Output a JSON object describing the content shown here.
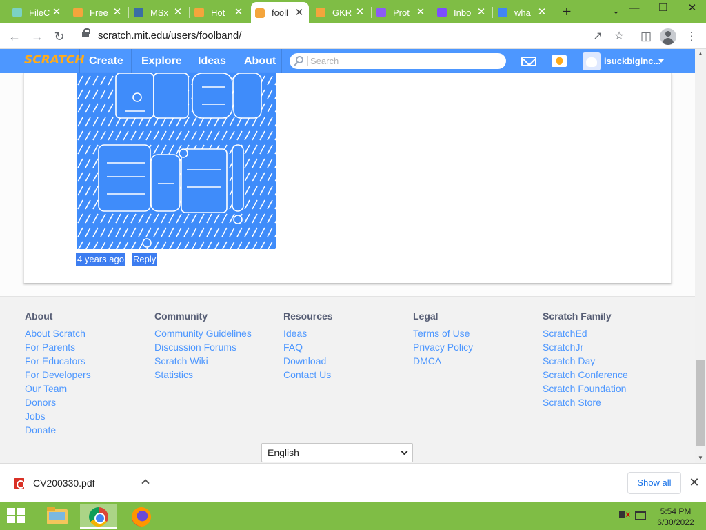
{
  "browser": {
    "tabs": [
      {
        "title": "FileC",
        "favicon_color": "#7bd2c4"
      },
      {
        "title": "Free",
        "favicon_color": "#f4a53c"
      },
      {
        "title": "MSx",
        "favicon_color": "#3a6ea5"
      },
      {
        "title": "Hot",
        "favicon_color": "#f4a53c"
      },
      {
        "title": "fooll",
        "favicon_color": "#f4a53c",
        "active": true
      },
      {
        "title": "GKR",
        "favicon_color": "#f4a53c"
      },
      {
        "title": "Prot",
        "favicon_color": "#8b5cf6"
      },
      {
        "title": "Inbo",
        "favicon_color": "#7c4dff"
      },
      {
        "title": "wha",
        "favicon_color": "#4285f4"
      }
    ],
    "new_tab_label": "+",
    "url": "scratch.mit.edu/users/foolband/"
  },
  "scratch_nav": {
    "logo": "SCRATCH",
    "links": [
      "Create",
      "Explore",
      "Ideas",
      "About"
    ],
    "search_placeholder": "Search",
    "username": "isuckbiginc..."
  },
  "comment": {
    "time": "4 years ago",
    "reply": "Reply"
  },
  "footer": {
    "columns": [
      {
        "heading": "About",
        "links": [
          "About Scratch",
          "For Parents",
          "For Educators",
          "For Developers",
          "Our Team",
          "Donors",
          "Jobs",
          "Donate"
        ]
      },
      {
        "heading": "Community",
        "links": [
          "Community Guidelines",
          "Discussion Forums",
          "Scratch Wiki",
          "Statistics"
        ]
      },
      {
        "heading": "Resources",
        "links": [
          "Ideas",
          "FAQ",
          "Download",
          "Contact Us"
        ]
      },
      {
        "heading": "Legal",
        "links": [
          "Terms of Use",
          "Privacy Policy",
          "DMCA"
        ]
      },
      {
        "heading": "Scratch Family",
        "links": [
          "ScratchEd",
          "ScratchJr",
          "Scratch Day",
          "Scratch Conference",
          "Scratch Foundation",
          "Scratch Store"
        ]
      }
    ],
    "language": "English"
  },
  "downloads": {
    "file": "CV200330.pdf",
    "show_all": "Show all"
  },
  "taskbar": {
    "time": "5:54 PM",
    "date": "6/30/2022"
  },
  "colors": {
    "scratch_blue": "#4d97ff",
    "browser_frame": "#7fbd45",
    "link": "#4d97ff"
  }
}
